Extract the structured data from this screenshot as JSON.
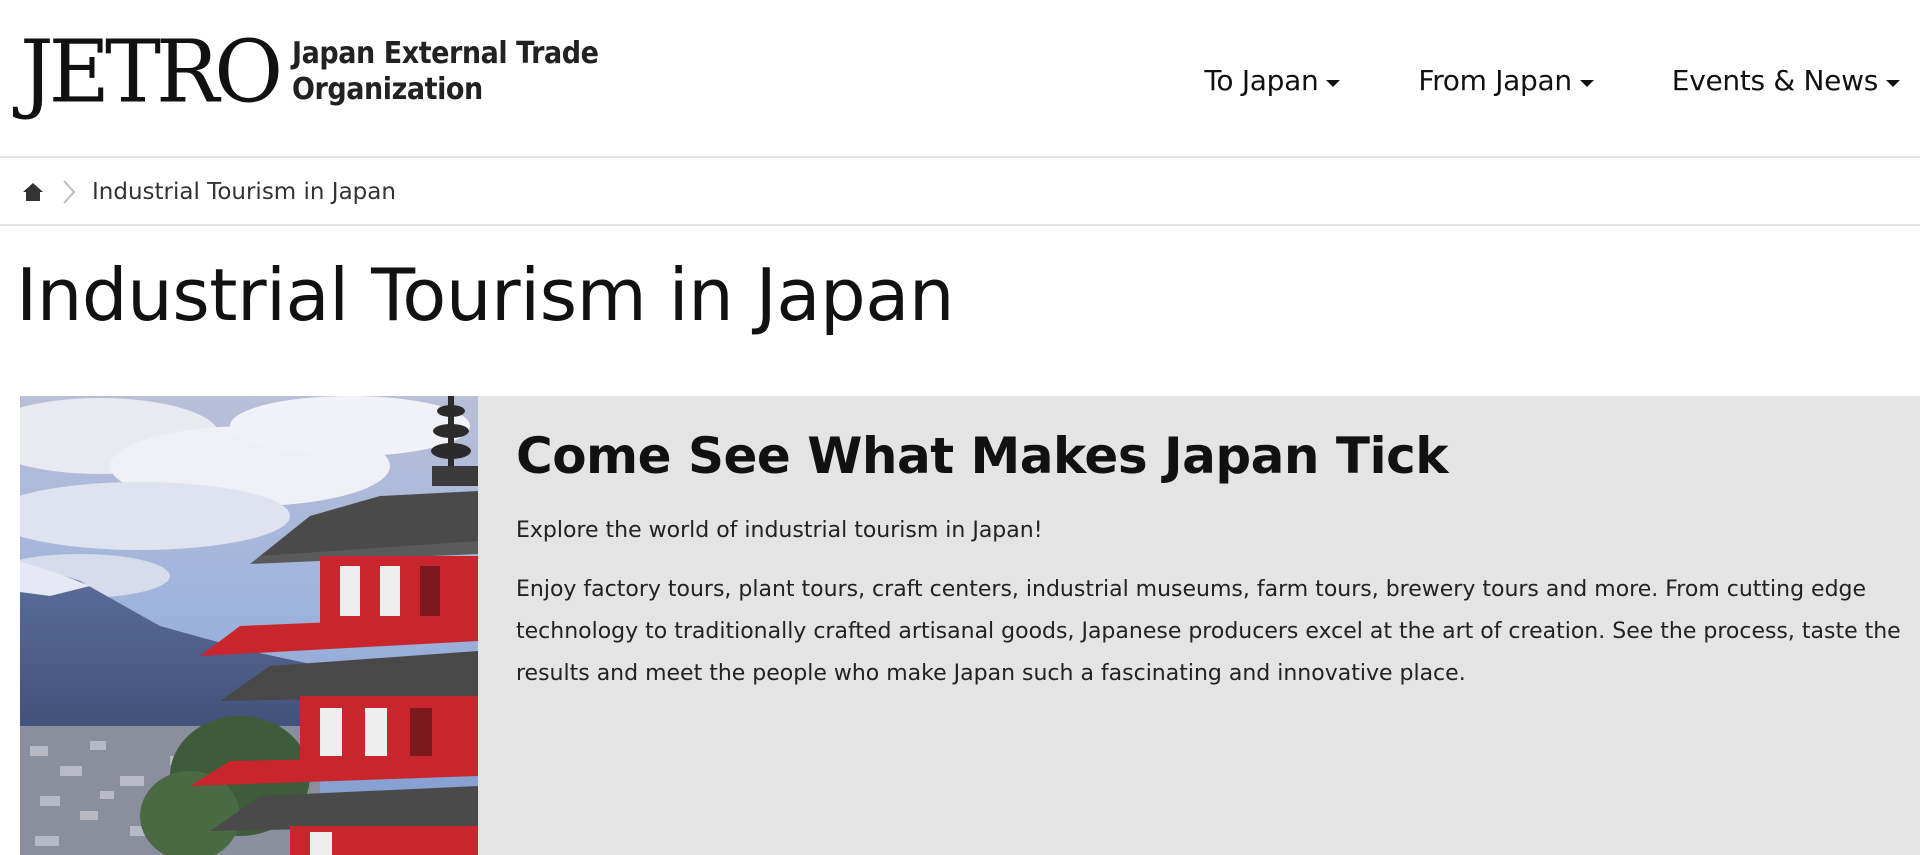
{
  "header": {
    "logo_mark": "JETRO",
    "logo_line1": "Japan External Trade",
    "logo_line2": "Organization",
    "nav": [
      {
        "label": "To Japan"
      },
      {
        "label": "From Japan"
      },
      {
        "label": "Events & News"
      }
    ]
  },
  "breadcrumb": {
    "home_icon": "home-icon",
    "current": "Industrial Tourism in Japan"
  },
  "page_title": "Industrial Tourism in Japan",
  "feature": {
    "image_subject": "pagoda-and-mountain",
    "heading": "Come See What Makes Japan Tick",
    "intro": "Explore the world of industrial tourism in Japan!",
    "description": "Enjoy factory tours, plant tours, craft centers, industrial museums, farm tours, brewery tours and more. From cutting edge technology to traditionally crafted artisanal goods, Japanese producers excel at the art of creation. See the process, taste the results and meet the people who make Japan such a fascinating and innovative place."
  },
  "colors": {
    "panel_bg": "#e4e4e4",
    "pagoda_red": "#c8262c",
    "divider": "#e6e6e6"
  }
}
